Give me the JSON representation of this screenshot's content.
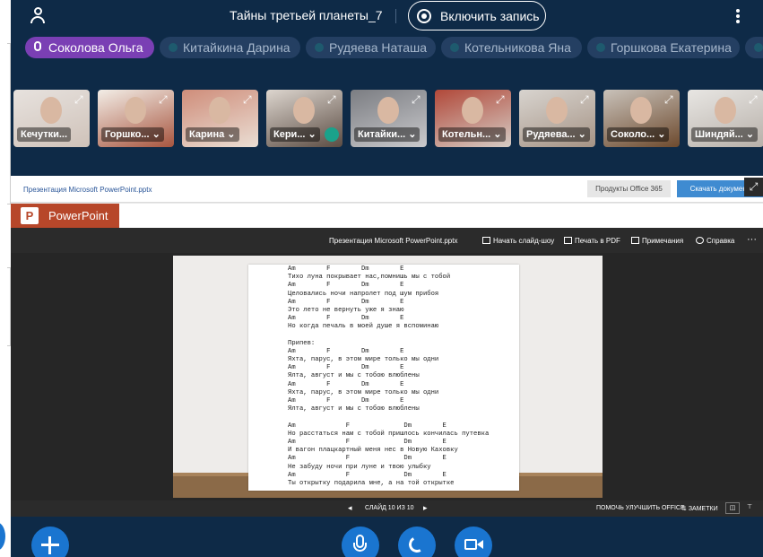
{
  "header": {
    "meeting_title": "Тайны третьей планеты_7",
    "record_label": "Включить запись"
  },
  "participants": [
    {
      "name": "Соколова Ольга",
      "active": true
    },
    {
      "name": "Китайкина Дарина",
      "active": false
    },
    {
      "name": "Рудяева Наташа",
      "active": false
    },
    {
      "name": "Котельникова Яна",
      "active": false
    },
    {
      "name": "Горшкова Екатерина",
      "active": false
    }
  ],
  "thumbnails": [
    {
      "name": "Кечутки...",
      "has_menu": false
    },
    {
      "name": "Горшко...",
      "has_menu": true
    },
    {
      "name": "Карина",
      "has_menu": true
    },
    {
      "name": "Кери...",
      "has_menu": true,
      "headphones": true
    },
    {
      "name": "Китайки...",
      "has_menu": true
    },
    {
      "name": "Котельн...",
      "has_menu": true
    },
    {
      "name": "Рудяева...",
      "has_menu": true
    },
    {
      "name": "Соколо...",
      "has_menu": true
    },
    {
      "name": "Шиндяй...",
      "has_menu": true
    }
  ],
  "document": {
    "filename": "Презентация Microsoft PowerPoint.pptx",
    "products_button": "Продукты Office 365",
    "download_button": "Скачать документ",
    "app_name": "PowerPoint",
    "toolbar_filename": "Презентация Microsoft PowerPoint.pptx",
    "toolbar": {
      "start_slideshow": "Начать слайд-шоу",
      "print_pdf": "Печать в PDF",
      "notes": "Примечания",
      "help": "Справка"
    },
    "slide_counter": "СЛАЙД 10 ИЗ 10",
    "improve_office": "ПОМОЧЬ УЛУЧШИТЬ OFFICE",
    "notes_toggle": "ЗАМЕТКИ"
  },
  "slide_lines": [
    "Am        F        Dm        E",
    "Тихо луна покрывает нас,помнишь мы с тобой",
    "Am        F        Dm        E",
    "Целовались ночи напролет под шум прибоя",
    "Am        F        Dm        E",
    "Это лето не вернуть уже я знаю",
    "Am        F        Dm        E",
    "Но когда печаль в моей душе я вспоминаю",
    "",
    "Припев:",
    "Am        F        Dm        E",
    "Яхта, парус, в этом мире только мы одни",
    "Am        F        Dm        E",
    "Ялта, август и мы с тобою влюблены",
    "Am        F        Dm        E",
    "Яхта, парус, в этом мире только мы одни",
    "Am        F        Dm        E",
    "Ялта, август и мы с тобою влюблены",
    "",
    "Am             F              Dm        E",
    "Но расстаться нам с тобой пришлось кончилась путевка",
    "Am             F              Dm        E",
    "И вагон плацкартный меня нес в Новую Каховку",
    "Am             F              Dm        E",
    "Не забуду ночи при луне и твою улыбку",
    "Am             F              Dm        E",
    "Ты открытку подарила мне, а на той открытке"
  ],
  "colors": {
    "background": "#0e2a47",
    "active_pill": "#7a3fb4",
    "pill": "#243f62",
    "accent_blue": "#1a75d0",
    "powerpoint_red": "#b7472a"
  }
}
